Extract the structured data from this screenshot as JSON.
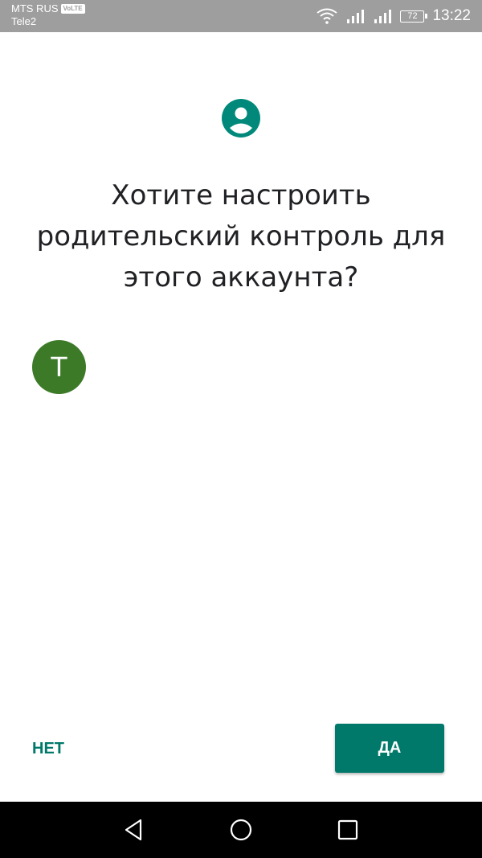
{
  "status_bar": {
    "carrier_primary": "MTS RUS",
    "volte_badge": "VoLTE",
    "carrier_secondary": "Tele2",
    "battery_level": "72",
    "time": "13:22",
    "background_color": "#9e9e9e"
  },
  "icons": {
    "header": "account-circle-icon",
    "nav_back": "back-triangle-icon",
    "nav_home": "home-circle-icon",
    "nav_recents": "recents-square-icon"
  },
  "main": {
    "question": "Хотите настроить родительский контроль для этого аккаунта?",
    "account_initial": "T",
    "avatar_color": "#3c7a28"
  },
  "actions": {
    "no_label": "НЕТ",
    "yes_label": "ДА",
    "accent_color": "#00796b"
  }
}
